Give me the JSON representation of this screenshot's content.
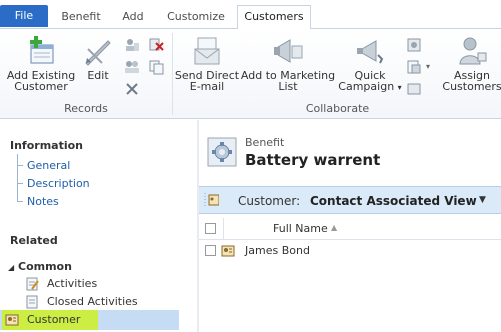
{
  "tabs": [
    {
      "label": "File"
    },
    {
      "label": "Benefit"
    },
    {
      "label": "Add"
    },
    {
      "label": "Customize"
    },
    {
      "label": "Customers"
    }
  ],
  "ribbon": {
    "add_existing_line1": "Add Existing",
    "add_existing_line2": "Customer",
    "edit": "Edit",
    "send_email_line1": "Send Direct",
    "send_email_line2": "E-mail",
    "add_marketing_line1": "Add to Marketing",
    "add_marketing_line2": "List",
    "quick_campaign_line1": "Quick",
    "quick_campaign_line2": "Campaign",
    "assign_line1": "Assign",
    "assign_line2": "Customers",
    "group_records": "Records",
    "group_collaborate": "Collaborate"
  },
  "nav": {
    "information_heading": "Information",
    "info_links": [
      "General",
      "Description",
      "Notes"
    ],
    "related_heading": "Related",
    "common_heading": "Common",
    "related_items": [
      {
        "label": "Activities",
        "icon": "activities-icon"
      },
      {
        "label": "Closed Activities",
        "icon": "closed-activities-icon"
      },
      {
        "label": "Customer",
        "icon": "customer-icon"
      }
    ],
    "selected_color": "#ccee44"
  },
  "record": {
    "entity": "Benefit",
    "name": "Battery warrent"
  },
  "view": {
    "entity_label": "Customer:",
    "view_name": "Contact Associated View"
  },
  "grid": {
    "columns": [
      "Full Name"
    ],
    "rows": [
      {
        "full_name": "James Bond"
      }
    ]
  },
  "colors": {
    "file_tab": "#2b6cc7",
    "link": "#1e5fa8",
    "view_bar": "#dbeaf8"
  }
}
